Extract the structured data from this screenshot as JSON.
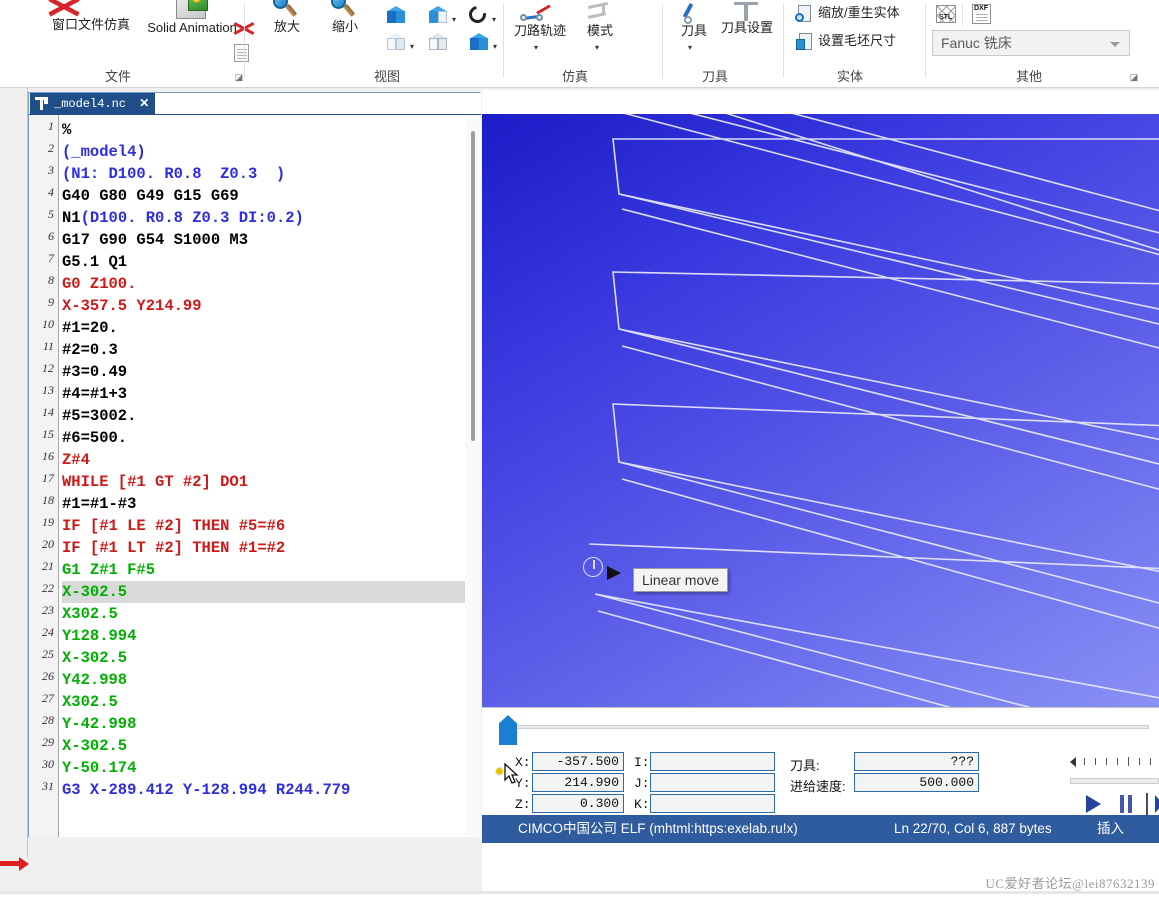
{
  "ribbon": {
    "groups": [
      {
        "caption": "文件",
        "items": [
          {
            "label": "窗口文件仿真",
            "icon": "window-file-sim-icon"
          },
          {
            "label": "Solid Animation",
            "icon": "solid-animation-icon"
          },
          {
            "label": "",
            "icon": "delete-red-x-icon"
          },
          {
            "label": "",
            "icon": "page-properties-icon"
          }
        ],
        "launcher": "◪"
      },
      {
        "caption": "视图",
        "items": [
          {
            "label": "放大",
            "icon": "zoom-in-icon"
          },
          {
            "label": "缩小",
            "icon": "zoom-out-icon"
          },
          {
            "label": "",
            "icon": "fit-cube-icon"
          },
          {
            "label": "",
            "icon": "section-cube-icon"
          },
          {
            "label": "",
            "icon": "rotate-icon"
          },
          {
            "label": "",
            "icon": "iso-cube-icon"
          },
          {
            "label": "",
            "icon": "wireframe-cube-icon"
          },
          {
            "label": "",
            "icon": "shade-cube-icon"
          }
        ]
      },
      {
        "caption": "仿真",
        "items": [
          {
            "label": "刀路轨迹",
            "icon": "toolpath-icon"
          },
          {
            "label": "模式",
            "icon": "mode-icon"
          }
        ]
      },
      {
        "caption": "刀具",
        "items": [
          {
            "label": "刀具",
            "icon": "tool-icon"
          },
          {
            "label": "刀具设置",
            "icon": "tool-settings-icon"
          }
        ]
      },
      {
        "caption": "实体",
        "items": [
          {
            "label": "缩放/重生实体",
            "icon": "regen-solid-icon"
          },
          {
            "label": "设置毛坯尺寸",
            "icon": "set-stock-size-icon"
          }
        ]
      },
      {
        "caption": "其他",
        "items": [
          {
            "label": "",
            "icon": "stl-export-icon"
          },
          {
            "label": "",
            "icon": "dxf-export-icon"
          }
        ],
        "combo_value": "Fanuc 铣床",
        "launcher": "◪"
      }
    ]
  },
  "editor": {
    "tab_label": "_model4.nc",
    "tab_close": "✕",
    "tab_icon": "nc-file-icon",
    "highlight_line": 22,
    "lines": [
      {
        "n": 1,
        "text": "%",
        "color": "black"
      },
      {
        "n": 2,
        "text": "(_model4)",
        "color": "blue"
      },
      {
        "n": 3,
        "text": "(N1: D100. R0.8  Z0.3  )",
        "color": "blue"
      },
      {
        "n": 4,
        "text": "G40 G80 G49 G15 G69",
        "color": "black"
      },
      {
        "n": 5,
        "text": "N1(D100. R0.8 Z0.3 DI:0.2)",
        "color": "blue",
        "prefix": "N1",
        "prefix_color": "black"
      },
      {
        "n": 6,
        "text": "G17 G90 G54 S1000 M3",
        "color": "black"
      },
      {
        "n": 7,
        "text": "G5.1 Q1",
        "color": "black"
      },
      {
        "n": 8,
        "text": "G0 Z100.",
        "color": "red"
      },
      {
        "n": 9,
        "text": "X-357.5 Y214.99",
        "color": "red"
      },
      {
        "n": 10,
        "text": "#1=20.",
        "color": "black"
      },
      {
        "n": 11,
        "text": "#2=0.3",
        "color": "black"
      },
      {
        "n": 12,
        "text": "#3=0.49",
        "color": "black"
      },
      {
        "n": 13,
        "text": "#4=#1+3",
        "color": "black"
      },
      {
        "n": 14,
        "text": "#5=3002.",
        "color": "black"
      },
      {
        "n": 15,
        "text": "#6=500.",
        "color": "black"
      },
      {
        "n": 16,
        "text": "Z#4",
        "color": "red"
      },
      {
        "n": 17,
        "text": "WHILE [#1 GT #2] DO1",
        "color": "red"
      },
      {
        "n": 18,
        "text": "#1=#1-#3",
        "color": "black"
      },
      {
        "n": 19,
        "text": "IF [#1 LE #2] THEN #5=#6",
        "color": "red"
      },
      {
        "n": 20,
        "text": "IF [#1 LT #2] THEN #1=#2",
        "color": "red"
      },
      {
        "n": 21,
        "text": "G1 Z#1 F#5",
        "color": "green"
      },
      {
        "n": 22,
        "text": "X-302.5",
        "color": "green"
      },
      {
        "n": 23,
        "text": "X302.5",
        "color": "green"
      },
      {
        "n": 24,
        "text": "Y128.994",
        "color": "green"
      },
      {
        "n": 25,
        "text": "X-302.5",
        "color": "green"
      },
      {
        "n": 26,
        "text": "Y42.998",
        "color": "green"
      },
      {
        "n": 27,
        "text": "X302.5",
        "color": "green"
      },
      {
        "n": 28,
        "text": "Y-42.998",
        "color": "green"
      },
      {
        "n": 29,
        "text": "X-302.5",
        "color": "green"
      },
      {
        "n": 30,
        "text": "Y-50.174",
        "color": "green"
      },
      {
        "n": 31,
        "text": "G3 X-289.412 Y-128.994 R244.779",
        "color": "blue"
      }
    ],
    "marker_line": 30,
    "marker_icon": "red-arrow-marker-icon"
  },
  "viewport": {
    "tooltip": "Linear move",
    "tool_marker_icon": "tool-position-icon",
    "cursor_icon": "pointer-arrow-icon",
    "bg_top_color": "#1c1cc8",
    "bg_bottom_color": "#8a90f4",
    "path_color": "#e8e9fb"
  },
  "info_panel": {
    "position_fields": [
      {
        "label": "X:",
        "value": "-357.500"
      },
      {
        "label": "Y:",
        "value": "214.990"
      },
      {
        "label": "Z:",
        "value": "0.300"
      }
    ],
    "ijk_fields": [
      {
        "label": "I:",
        "value": ""
      },
      {
        "label": "J:",
        "value": ""
      },
      {
        "label": "K:",
        "value": ""
      }
    ],
    "machine_fields": [
      {
        "label": "刀具:",
        "value": "???"
      },
      {
        "label": "进给速度:",
        "value": "500.000"
      }
    ],
    "slider_icon": "progress-handle-icon",
    "playback": {
      "play": "play-button-icon",
      "pause": "pause-button-icon",
      "step_end": "skip-end-button-icon"
    }
  },
  "status_bar": {
    "left": "CIMCO中国公司 ELF (mhtml:https:exelab.ru!x)",
    "middle": "Ln 22/70, Col 6, 887 bytes",
    "right": "插入"
  },
  "watermark": "UC爱好者论坛@lei87632139"
}
